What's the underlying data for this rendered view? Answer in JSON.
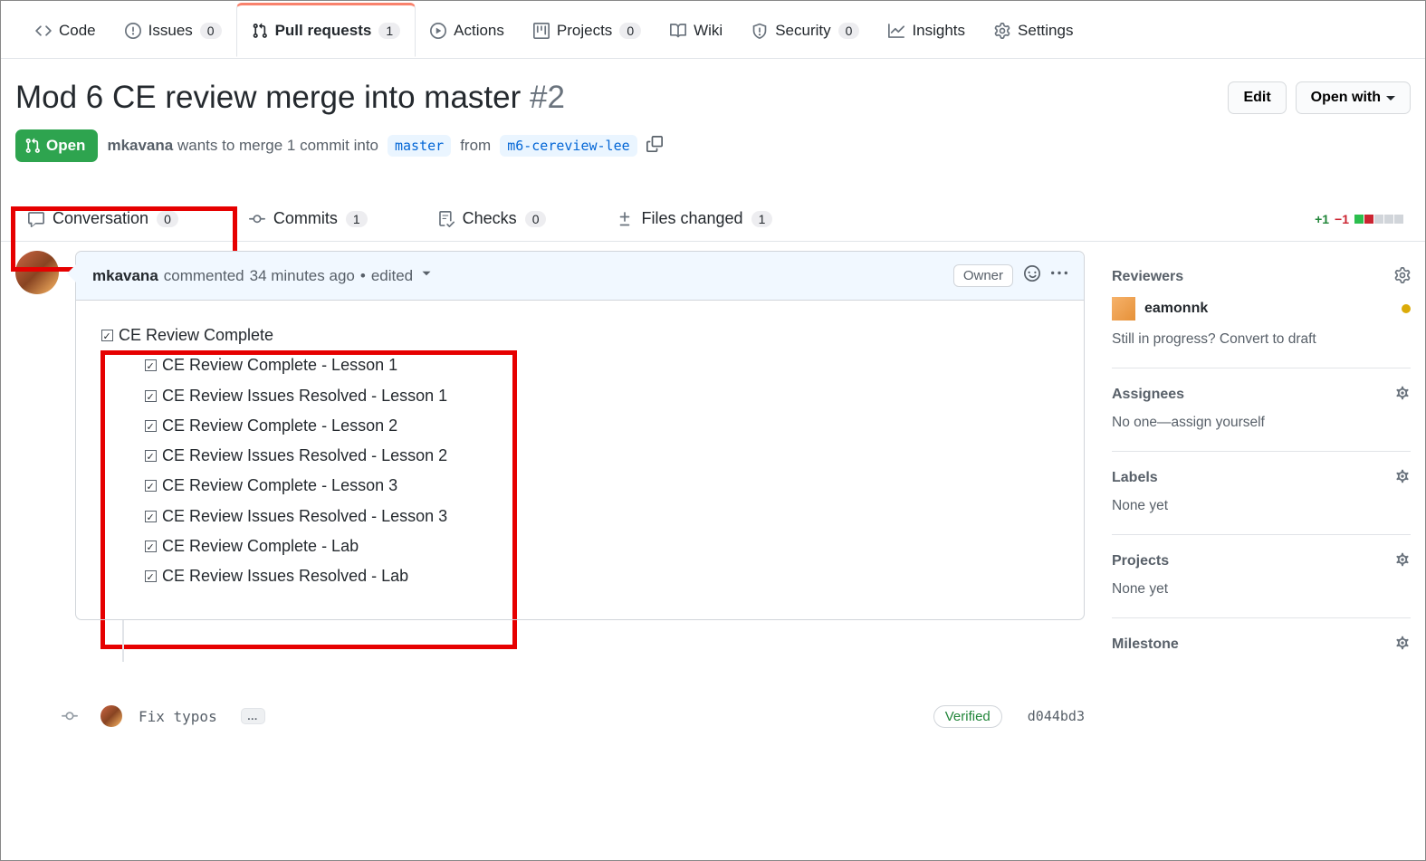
{
  "repo_tabs": {
    "code": "Code",
    "issues": {
      "label": "Issues",
      "count": "0"
    },
    "pulls": {
      "label": "Pull requests",
      "count": "1"
    },
    "actions": "Actions",
    "projects": {
      "label": "Projects",
      "count": "0"
    },
    "wiki": "Wiki",
    "security": {
      "label": "Security",
      "count": "0"
    },
    "insights": "Insights",
    "settings": "Settings"
  },
  "pr": {
    "title": "Mod 6 CE review merge into master",
    "number": "#2",
    "state": "Open",
    "author": "mkavana",
    "merge_text_1": "wants to merge 1 commit into",
    "base": "master",
    "merge_text_2": "from",
    "head": "m6-cereview-lee",
    "edit_btn": "Edit",
    "open_with_btn": "Open with"
  },
  "pr_tabs": {
    "conversation": {
      "label": "Conversation",
      "count": "0"
    },
    "commits": {
      "label": "Commits",
      "count": "1"
    },
    "checks": {
      "label": "Checks",
      "count": "0"
    },
    "files": {
      "label": "Files changed",
      "count": "1"
    }
  },
  "diffstat": {
    "add": "+1",
    "del": "−1"
  },
  "comment": {
    "author": "mkavana",
    "action": "commented",
    "time": "34 minutes ago",
    "edited": "edited",
    "owner": "Owner",
    "root": "CE Review Complete",
    "items": [
      "CE Review Complete - Lesson 1",
      "CE Review Issues Resolved - Lesson 1",
      "CE Review Complete - Lesson 2",
      "CE Review Issues Resolved - Lesson 2",
      "CE Review Complete - Lesson 3",
      "CE Review Issues Resolved - Lesson 3",
      "CE Review Complete - Lab",
      "CE Review Issues Resolved - Lab"
    ]
  },
  "commit": {
    "msg": "Fix typos",
    "verified": "Verified",
    "sha": "d044bd3"
  },
  "sidebar": {
    "reviewers_title": "Reviewers",
    "reviewer_name": "eamonnk",
    "reviewer_hint": "Still in progress? Convert to draft",
    "assignees_title": "Assignees",
    "assignees_body": "No one—assign yourself",
    "labels_title": "Labels",
    "labels_body": "None yet",
    "projects_title": "Projects",
    "projects_body": "None yet",
    "milestone_title": "Milestone"
  }
}
